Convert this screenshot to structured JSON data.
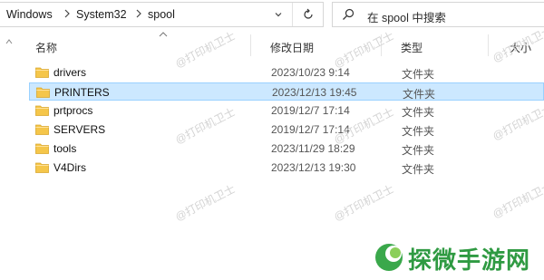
{
  "address": {
    "crumbs": [
      "Windows",
      "System32",
      "spool"
    ],
    "separator": ">"
  },
  "search": {
    "placeholder": "在 spool 中搜索"
  },
  "columns": {
    "name": "名称",
    "date": "修改日期",
    "type": "类型",
    "size": "大小"
  },
  "files": [
    {
      "name": "drivers",
      "date": "2023/10/23 9:14",
      "type": "文件夹",
      "selected": false
    },
    {
      "name": "PRINTERS",
      "date": "2023/12/13 19:45",
      "type": "文件夹",
      "selected": true
    },
    {
      "name": "prtprocs",
      "date": "2019/12/7 17:14",
      "type": "文件夹",
      "selected": false
    },
    {
      "name": "SERVERS",
      "date": "2019/12/7 17:14",
      "type": "文件夹",
      "selected": false
    },
    {
      "name": "tools",
      "date": "2023/11/29 18:29",
      "type": "文件夹",
      "selected": false
    },
    {
      "name": "V4Dirs",
      "date": "2023/12/13 19:30",
      "type": "文件夹",
      "selected": false
    }
  ],
  "watermark": "@打印机卫士",
  "brand": {
    "text": "探微手游网"
  },
  "colors": {
    "selection_bg": "#cce8ff",
    "selection_border": "#99d1ff",
    "folder": "#f5c64a",
    "brand": "#2f9a42"
  },
  "icons": {
    "folder": "folder-icon",
    "search": "search-icon",
    "refresh": "refresh-icon",
    "dropdown": "chevron-down-icon",
    "separator": "chevron-right-icon",
    "sort": "sort-up-icon",
    "brand": "leaf-logo-icon"
  }
}
